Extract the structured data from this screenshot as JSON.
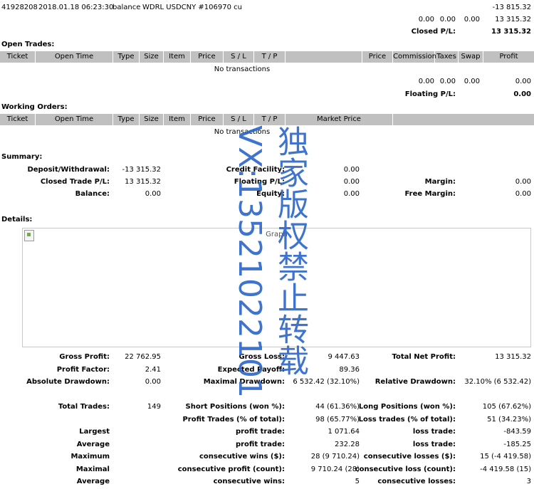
{
  "top": {
    "id": "41928208",
    "time": "2018.01.18 06:23:30",
    "type": "balance",
    "comment": "WDRL USDCNY #106970 cu",
    "amount": "-13 815.32",
    "subtotals": [
      "0.00",
      "0.00",
      "0.00",
      "13 315.32"
    ],
    "closed_pl_label": "Closed P/L:",
    "closed_pl_value": "13 315.32"
  },
  "open_trades": {
    "title": "Open Trades:",
    "columns": [
      "Ticket",
      "Open Time",
      "Type",
      "Size",
      "Item",
      "Price",
      "S / L",
      "T / P",
      "",
      "Price",
      "Commission",
      "Taxes",
      "Swap",
      "Profit"
    ],
    "empty": "No transactions",
    "subtotals": [
      "0.00",
      "0.00",
      "0.00",
      "0.00"
    ],
    "floating_pl_label": "Floating P/L:",
    "floating_pl_value": "0.00"
  },
  "working_orders": {
    "title": "Working Orders:",
    "columns": [
      "Ticket",
      "Open Time",
      "Type",
      "Size",
      "Item",
      "Price",
      "S / L",
      "T / P",
      "Market Price",
      ""
    ],
    "empty": "No transactions"
  },
  "summary": {
    "title": "Summary:",
    "rows": [
      [
        "Deposit/Withdrawal:",
        "-13 315.32",
        "Credit Facility:",
        "0.00",
        "",
        ""
      ],
      [
        "Closed Trade P/L:",
        "13 315.32",
        "Floating P/L:",
        "0.00",
        "Margin:",
        "0.00"
      ],
      [
        "Balance:",
        "0.00",
        "Equity:",
        "0.00",
        "Free Margin:",
        "0.00"
      ]
    ]
  },
  "details": {
    "title": "Details:",
    "graph_alt": "Graph",
    "block1": [
      [
        "Gross Profit:",
        "22 762.95",
        "Gross Loss:",
        "9 447.63",
        "Total Net Profit:",
        "13 315.32"
      ],
      [
        "Profit Factor:",
        "2.41",
        "Expected Payoff:",
        "89.36",
        "",
        ""
      ],
      [
        "Absolute Drawdown:",
        "0.00",
        "Maximal Drawdown:",
        "6 532.42 (32.10%)",
        "Relative Drawdown:",
        "32.10% (6 532.42)"
      ]
    ],
    "block2": [
      [
        "Total Trades:",
        "149",
        "Short Positions (won %):",
        "44 (61.36%)",
        "Long Positions (won %):",
        "105 (67.62%)"
      ],
      [
        "",
        "",
        "Profit Trades (% of total):",
        "98 (65.77%)",
        "Loss trades (% of total):",
        "51 (34.23%)"
      ],
      [
        "Largest",
        "",
        "profit trade:",
        "1 071.64",
        "loss trade:",
        "-843.59"
      ],
      [
        "Average",
        "",
        "profit trade:",
        "232.28",
        "loss trade:",
        "-185.25"
      ],
      [
        "Maximum",
        "",
        "consecutive wins ($):",
        "28 (9 710.24)",
        "consecutive losses ($):",
        "15 (-4 419.58)"
      ],
      [
        "Maximal",
        "",
        "consecutive profit (count):",
        "9 710.24 (28)",
        "consecutive loss (count):",
        "-4 419.58 (15)"
      ],
      [
        "Average",
        "",
        "consecutive wins:",
        "5",
        "consecutive losses:",
        "3"
      ]
    ]
  },
  "watermark": {
    "line1": "VX:13521022101",
    "line2": "独家版权禁止转载"
  }
}
